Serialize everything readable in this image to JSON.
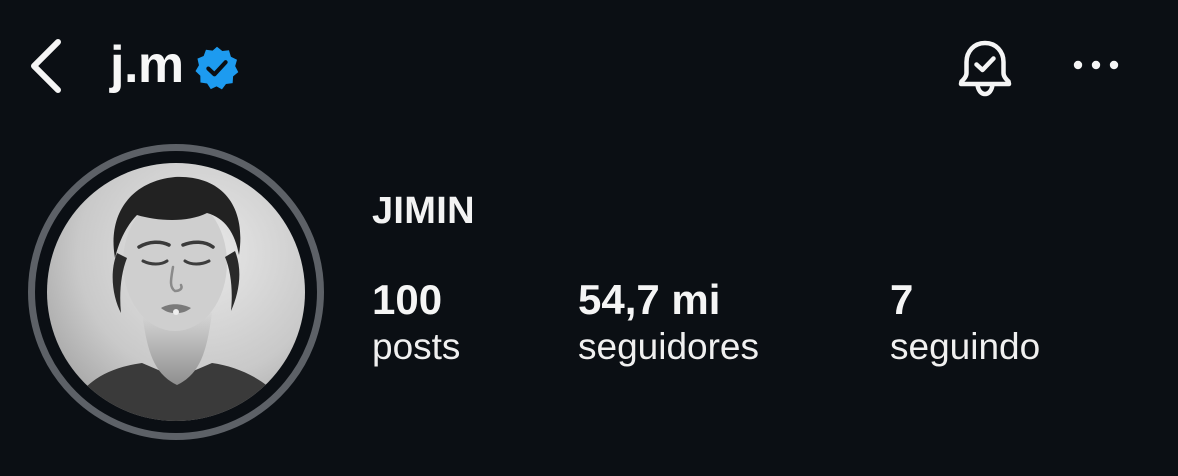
{
  "header": {
    "username": "j.m",
    "back_icon": "chevron-left-icon",
    "verified_icon": "verified-badge-icon",
    "notification_icon": "bell-check-icon",
    "more_icon": "more-horizontal-icon"
  },
  "profile": {
    "display_name": "JIMIN",
    "stats": [
      {
        "value": "100",
        "label": "posts"
      },
      {
        "value": "54,7 mi",
        "label": "seguidores"
      },
      {
        "value": "7",
        "label": "seguindo"
      }
    ]
  },
  "colors": {
    "background": "#0b0f14",
    "text": "#f5f5f5",
    "verified_blue": "#1d9bf0",
    "avatar_ring": "#5d6167"
  }
}
